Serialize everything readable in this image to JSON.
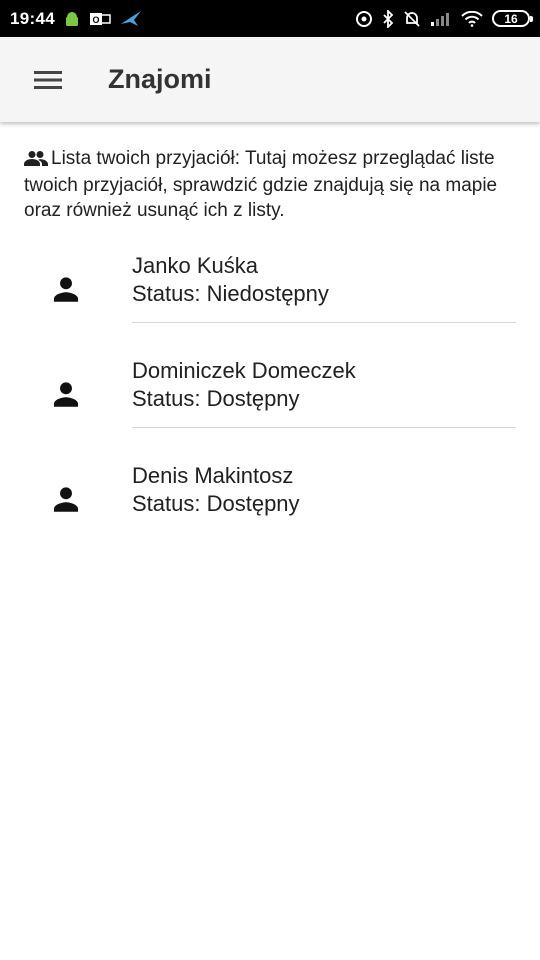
{
  "status_bar": {
    "time": "19:44",
    "battery": "16"
  },
  "app_bar": {
    "title": "Znajomi"
  },
  "intro": {
    "text": "Lista twoich przyjaciół: Tutaj możesz przeglądać liste twoich przyjaciół, sprawdzić gdzie znajdują się na mapie oraz również usunąć ich z listy."
  },
  "friends": [
    {
      "name": "Janko Kuśka",
      "status": "Status: Niedostępny"
    },
    {
      "name": "Dominiczek Domeczek",
      "status": "Status: Dostępny"
    },
    {
      "name": "Denis Makintosz",
      "status": "Status: Dostępny"
    }
  ]
}
